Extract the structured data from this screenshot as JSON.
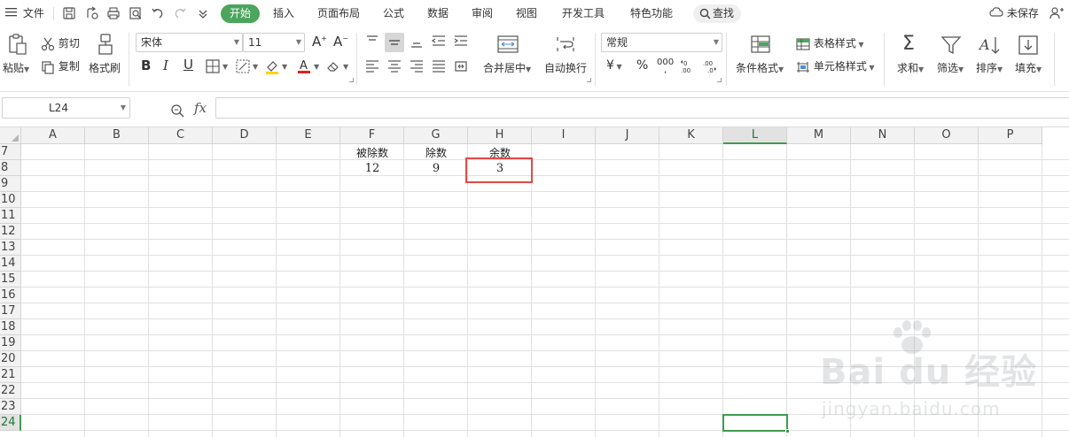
{
  "menubar": {
    "file": "文件",
    "tabs": [
      "开始",
      "插入",
      "页面布局",
      "公式",
      "数据",
      "审阅",
      "视图",
      "开发工具",
      "特色功能"
    ],
    "search": "查找",
    "unsaved": "未保存"
  },
  "ribbon": {
    "paste": "粘贴",
    "cut": "剪切",
    "copy": "复制",
    "format_painter": "格式刷",
    "font_name": "宋体",
    "font_size": "11",
    "merge_center": "合并居中",
    "wrap_text": "自动换行",
    "number_format": "常规",
    "currency_symbol": "¥",
    "percent": "%",
    "thousands": "000",
    "conditional_format": "条件格式",
    "table_style": "表格样式",
    "cell_style": "单元格样式",
    "sum": "求和",
    "filter": "筛选",
    "sort": "排序",
    "fill": "填充",
    "colors": {
      "accent_green": "#4ca55c",
      "font_color_bar": "#e02020",
      "highlight_bar": "#ffd400"
    }
  },
  "formula_bar": {
    "name_box": "L24",
    "fx": "fx",
    "value": ""
  },
  "sheet": {
    "columns": [
      "A",
      "B",
      "C",
      "D",
      "E",
      "F",
      "G",
      "H",
      "I",
      "J",
      "K",
      "L",
      "M",
      "N",
      "O",
      "P"
    ],
    "rows": [
      "7",
      "8",
      "9",
      "10",
      "11",
      "12",
      "13",
      "14",
      "15",
      "16",
      "17",
      "18",
      "19",
      "20",
      "21",
      "22",
      "23",
      "24"
    ],
    "active_column": "L",
    "active_row": "24",
    "cells": {
      "F7": "被除数",
      "G7": "除数",
      "H7": "余数",
      "F8": "12",
      "G8": "9",
      "H8": "3"
    },
    "highlight_color": "#e24a47",
    "selection_color": "#3f9b4f"
  },
  "watermark": {
    "logo": "Bai du 经验",
    "url": "jingyan.baidu.com"
  }
}
